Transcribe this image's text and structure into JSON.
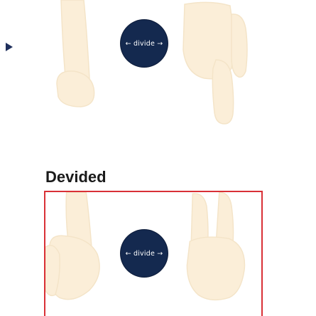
{
  "top_panel": {
    "button_label": "← divide →"
  },
  "section": {
    "title": "Devided"
  },
  "bottom_panel": {
    "button_label": "← divide →",
    "border_color": "#d93036"
  },
  "colors": {
    "button_bg": "#14294f",
    "hand_fill": "#fbeed8",
    "hand_stroke": "#f2e2c6",
    "arrow": "#1f2f5c"
  },
  "icons": {
    "play": "play-arrow-icon",
    "hand": "peace-hand-icon"
  }
}
